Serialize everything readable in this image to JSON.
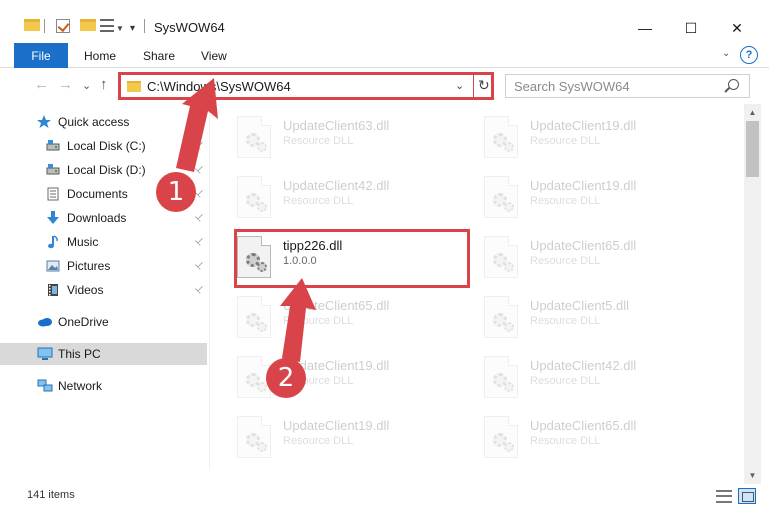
{
  "window": {
    "title": "SysWOW64",
    "controls": [
      "—",
      "☐",
      "✕"
    ]
  },
  "ribbon": {
    "tabs": [
      "File",
      "Home",
      "Share",
      "View"
    ],
    "help": "?",
    "collapse": "⌄"
  },
  "nav": {
    "back": "←",
    "forward": "→",
    "recent": "⌄",
    "up": "↑",
    "address": "C:\\Windows\\SysWOW64",
    "dropdown": "⌄",
    "refresh": "↻",
    "search_placeholder": "Search SysWOW64"
  },
  "sidebar": {
    "items": [
      {
        "label": "Quick access",
        "icon": "star-icon",
        "color": "#2f86d6",
        "pinned": false
      },
      {
        "label": "Local Disk (C:)",
        "icon": "drive-icon",
        "color": "#5a5a5a",
        "pinned": true
      },
      {
        "label": "Local Disk (D:)",
        "icon": "drive-icon",
        "color": "#5a5a5a",
        "pinned": true
      },
      {
        "label": "Documents",
        "icon": "documents-icon",
        "color": "#6a6a6a",
        "pinned": true
      },
      {
        "label": "Downloads",
        "icon": "downloads-icon",
        "color": "#2f86d6",
        "pinned": true
      },
      {
        "label": "Music",
        "icon": "music-icon",
        "color": "#2f86d6",
        "pinned": true
      },
      {
        "label": "Pictures",
        "icon": "pictures-icon",
        "color": "#5a7fa8",
        "pinned": true
      },
      {
        "label": "Videos",
        "icon": "videos-icon",
        "color": "#444444",
        "pinned": true
      },
      {
        "label": "OneDrive",
        "icon": "onedrive-icon",
        "color": "#1a6fc9",
        "pinned": false
      },
      {
        "label": "This PC",
        "icon": "pc-icon",
        "color": "#3a8fd6",
        "pinned": false,
        "selected": true
      },
      {
        "label": "Network",
        "icon": "network-icon",
        "color": "#3a8fd6",
        "pinned": false
      }
    ],
    "pin_glyph": "📌"
  },
  "files": [
    {
      "name": "UpdateClient63.dll",
      "sub": "Resource DLL"
    },
    {
      "name": "UpdateClient19.dll",
      "sub": "Resource DLL"
    },
    {
      "name": "UpdateClient42.dll",
      "sub": "Resource DLL"
    },
    {
      "name": "UpdateClient19.dll",
      "sub": "Resource DLL"
    },
    {
      "name": "tipp226.dll",
      "sub": "1.0.0.0",
      "highlighted": true
    },
    {
      "name": "UpdateClient65.dll",
      "sub": "Resource DLL"
    },
    {
      "name": "UpdateClient65.dll",
      "sub": "Resource DLL"
    },
    {
      "name": "UpdateClient5.dll",
      "sub": "Resource DLL"
    },
    {
      "name": "UpdateClient19.dll",
      "sub": "Resource DLL"
    },
    {
      "name": "UpdateClient42.dll",
      "sub": "Resource DLL"
    },
    {
      "name": "UpdateClient19.dll",
      "sub": "Resource DLL"
    },
    {
      "name": "UpdateClient65.dll",
      "sub": "Resource DLL"
    }
  ],
  "status": {
    "items": "141 items"
  },
  "callouts": {
    "one": "1",
    "two": "2",
    "color": "#d9444a"
  },
  "scrollbar": {
    "up": "▲",
    "down": "▼"
  }
}
